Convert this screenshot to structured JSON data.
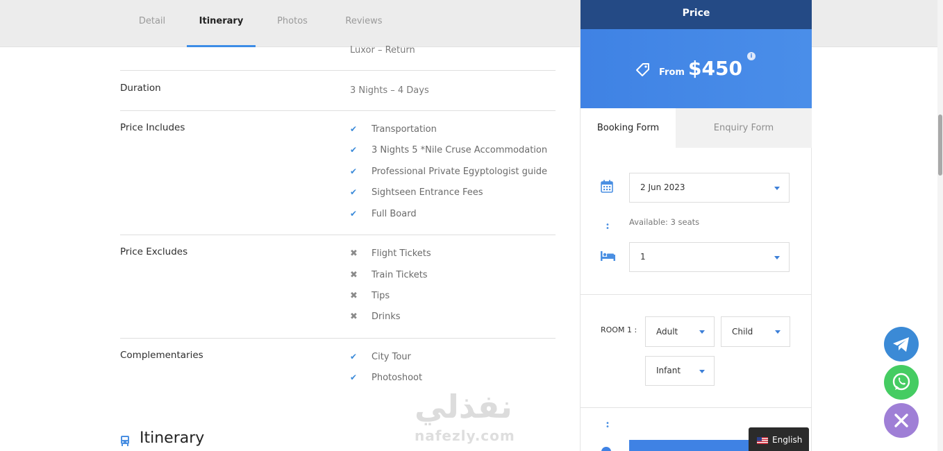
{
  "tabs": [
    {
      "label": "Detail"
    },
    {
      "label": "Itinerary"
    },
    {
      "label": "Photos"
    },
    {
      "label": "Reviews"
    }
  ],
  "details": {
    "route_value": "Luxor – Return",
    "duration": {
      "label": "Duration",
      "value": "3 Nights – 4 Days"
    },
    "price_includes": {
      "label": "Price Includes",
      "items": [
        "Transportation",
        "3 Nights 5 *Nile Cruse Accommodation",
        "Professional Private Egyptologist guide",
        "Sightseen Entrance Fees",
        "Full Board"
      ]
    },
    "price_excludes": {
      "label": "Price Excludes",
      "items": [
        "Flight Tickets",
        "Train Tickets",
        "Tips",
        "Drinks"
      ]
    },
    "complementaries": {
      "label": "Complementaries",
      "items": [
        "City Tour",
        "Photoshoot"
      ]
    }
  },
  "itinerary": {
    "heading": "Itinerary",
    "icon": "bus-icon"
  },
  "watermark": {
    "arabic": "نفذلي",
    "latin": "nafezly.com"
  },
  "sidebar": {
    "header": "Price",
    "from_label": "From",
    "price": "$450",
    "info": "i",
    "form_tabs": [
      "Booking Form",
      "Enquiry Form"
    ],
    "date": "2 Jun 2023",
    "availability": "Available: 3 seats",
    "quantity": "1",
    "room_label": "ROOM 1 :",
    "room_selects": [
      "Adult",
      "Child",
      "Infant"
    ]
  },
  "language": {
    "label": "English"
  },
  "floating": [
    "telegram-icon",
    "whatsapp-icon",
    "close-icon"
  ],
  "colors": {
    "accent": "#3f82e4",
    "header_dark": "#244a85",
    "whatsapp": "#45cc62",
    "telegram": "#3b8ad6",
    "close": "#9f7fd6"
  }
}
